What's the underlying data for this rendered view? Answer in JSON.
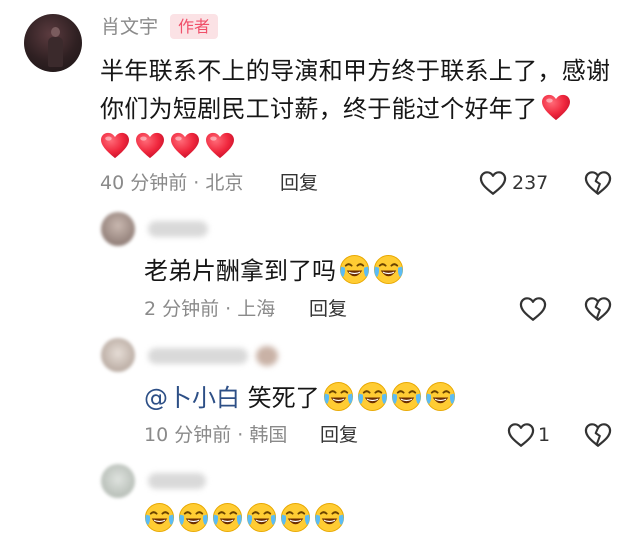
{
  "main_comment": {
    "author": "肖文宇",
    "badge": "作者",
    "text": "半年联系不上的导演和甲方终于联系上了，感谢你们为短剧民工讨薪，终于能过个好年了",
    "time_location": "40 分钟前 · 北京",
    "reply_label": "回复",
    "like_count": "237",
    "heart_emoji_count": 5
  },
  "replies": [
    {
      "text": "老弟片酬拿到了吗",
      "time_location": "2 分钟前 · 上海",
      "reply_label": "回复",
      "like_count": "",
      "laugh_emoji_count": 2
    },
    {
      "mention": "@卜小白",
      "text": " 笑死了",
      "time_location": "10 分钟前 · 韩国",
      "reply_label": "回复",
      "like_count": "1",
      "laugh_emoji_count": 4
    },
    {
      "text": "",
      "laugh_emoji_count": 6
    }
  ],
  "icons": {
    "like": "heart-outline-icon",
    "dislike": "broken-heart-icon",
    "heart_emoji": "red-heart-emoji",
    "laugh_emoji": "laughing-crying-emoji"
  },
  "colors": {
    "badge_bg": "#fbe2e5",
    "badge_text": "#f0506a",
    "mention": "#2d4f86",
    "meta_gray": "#8a8a8a"
  }
}
